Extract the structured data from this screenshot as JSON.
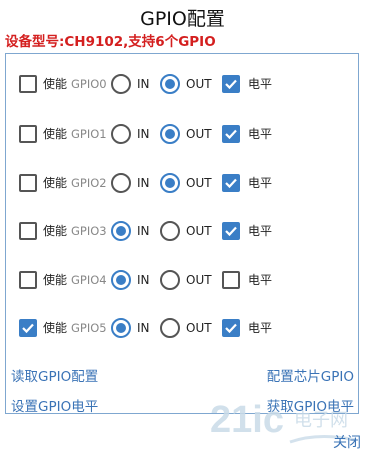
{
  "title": "GPIO配置",
  "device_info": "设备型号:CH9102,支持6个GPIO",
  "labels": {
    "enable": "使能",
    "in": "IN",
    "out": "OUT",
    "level": "电平"
  },
  "gpios": [
    {
      "name": "GPIO0",
      "enabled": false,
      "direction": "OUT",
      "level": true
    },
    {
      "name": "GPIO1",
      "enabled": false,
      "direction": "OUT",
      "level": true
    },
    {
      "name": "GPIO2",
      "enabled": false,
      "direction": "OUT",
      "level": true
    },
    {
      "name": "GPIO3",
      "enabled": false,
      "direction": "IN",
      "level": true
    },
    {
      "name": "GPIO4",
      "enabled": false,
      "direction": "IN",
      "level": false
    },
    {
      "name": "GPIO5",
      "enabled": true,
      "direction": "IN",
      "level": true
    }
  ],
  "actions": {
    "read_config": "读取GPIO配置",
    "configure_chip": "配置芯片GPIO",
    "set_level": "设置GPIO电平",
    "get_level": "获取GPIO电平"
  },
  "close": "关闭",
  "watermark": {
    "logo": "21ic",
    "text": "电子网"
  },
  "colors": {
    "accent": "#3a7ec6",
    "device_info": "#d41f1f",
    "link": "#3a73b6",
    "border": "#7fa7d0"
  }
}
